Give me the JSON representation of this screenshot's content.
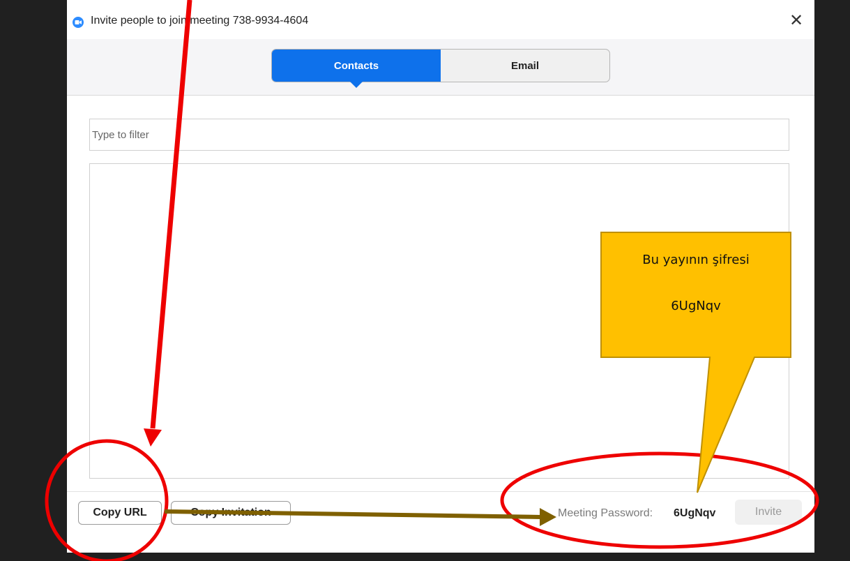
{
  "window": {
    "title": "Invite people to join meeting 738-9934-4604",
    "close_symbol": "✕"
  },
  "tabs": [
    {
      "label": "Contacts",
      "active": true
    },
    {
      "label": "Email",
      "active": false
    }
  ],
  "filter": {
    "placeholder": "Type to filter",
    "value": ""
  },
  "footer": {
    "copy_url_label": "Copy URL",
    "copy_invitation_label": "Copy Invitation",
    "password_label": "Meeting Password:",
    "password_value": "6UgNqv",
    "invite_label": "Invite"
  },
  "annotation": {
    "callout_line1": "Bu yayının şifresi",
    "callout_line2": "6UgNqv"
  },
  "colors": {
    "accent": "#0E71EB",
    "annotation_red": "#EE0000",
    "callout_fill": "#FFC000",
    "callout_border": "#BF9000",
    "arrow_brown": "#7F6000"
  },
  "icons": {
    "app": "zoom-camera-icon",
    "close": "close-icon"
  }
}
